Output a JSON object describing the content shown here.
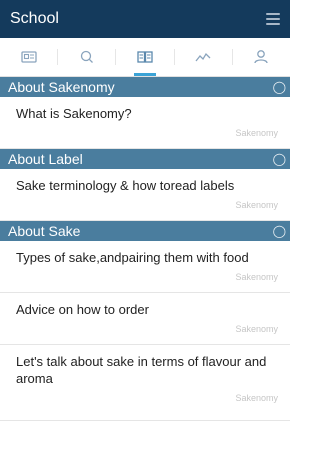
{
  "header": {
    "title": "School"
  },
  "tabs": [
    {
      "name": "tab-id-card",
      "icon": "id-card-icon",
      "active": false
    },
    {
      "name": "tab-search",
      "icon": "search-icon",
      "active": false
    },
    {
      "name": "tab-school",
      "icon": "book-icon",
      "active": true
    },
    {
      "name": "tab-chart",
      "icon": "chart-icon",
      "active": false
    },
    {
      "name": "tab-profile",
      "icon": "profile-icon",
      "active": false
    }
  ],
  "sections": [
    {
      "title": "About Sakenomy",
      "items": [
        {
          "title": "What is Sakenomy?",
          "source": "Sakenomy"
        }
      ]
    },
    {
      "title": "About Label",
      "items": [
        {
          "title": "Sake terminology & how toread labels",
          "source": "Sakenomy"
        }
      ]
    },
    {
      "title": "About Sake",
      "items": [
        {
          "title": "Types of sake,andpairing them with food",
          "source": "Sakenomy"
        },
        {
          "title": "Advice on how to order",
          "source": "Sakenomy"
        },
        {
          "title": "Let's talk about sake in terms of flavour and aroma",
          "source": "Sakenomy"
        }
      ]
    }
  ],
  "colors": {
    "header_bg": "#143a5c",
    "section_bg": "#4a7d9e",
    "tab_active": "#3ba3d6"
  }
}
